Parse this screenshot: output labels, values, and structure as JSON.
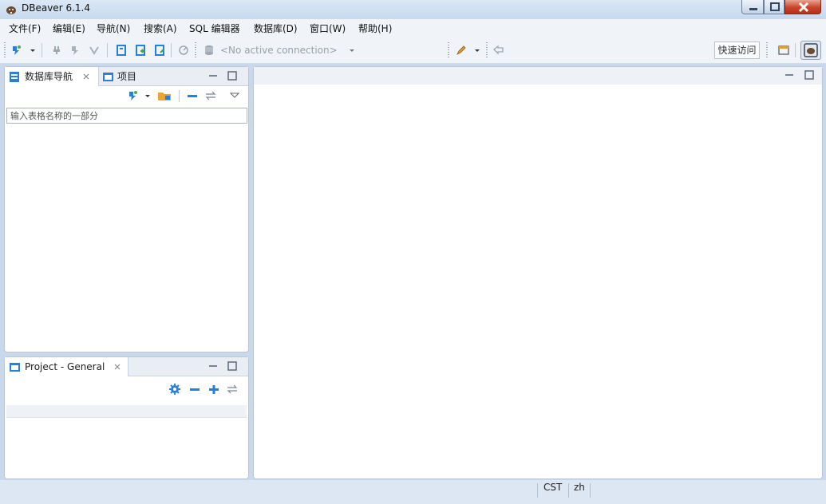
{
  "window": {
    "title": "DBeaver 6.1.4",
    "icon": "dbeaver-logo-icon"
  },
  "menu": [
    "文件(F)",
    "编辑(E)",
    "导航(N)",
    "搜索(A)",
    "SQL 编辑器",
    "数据库(D)",
    "窗口(W)",
    "帮助(H)"
  ],
  "toolbar": {
    "connection_placeholder": "<No active connection>",
    "quick_access": "快速访问",
    "icons": [
      "new-connection-icon",
      "dropdown-arrow-icon",
      "connect-icon",
      "disconnect-icon",
      "invalidate-icon",
      "sql-editor-icon",
      "new-script-icon",
      "recent-script-icon",
      "transaction-icon",
      "database-icon",
      "pen-icon",
      "back-icon",
      "perspective-icon",
      "dbeaver-perspective-icon"
    ]
  },
  "navigator": {
    "tab_db": "数据库导航",
    "tab_projects": "项目",
    "filter_placeholder": "输入表格名称的一部分"
  },
  "project_panel": {
    "tab": "Project - General"
  },
  "status": {
    "timezone": "CST",
    "locale": "zh"
  },
  "colors": {
    "accent": "#2a7fd4",
    "folder": "#e8a33d",
    "title_bar": "#c6d9ee"
  }
}
